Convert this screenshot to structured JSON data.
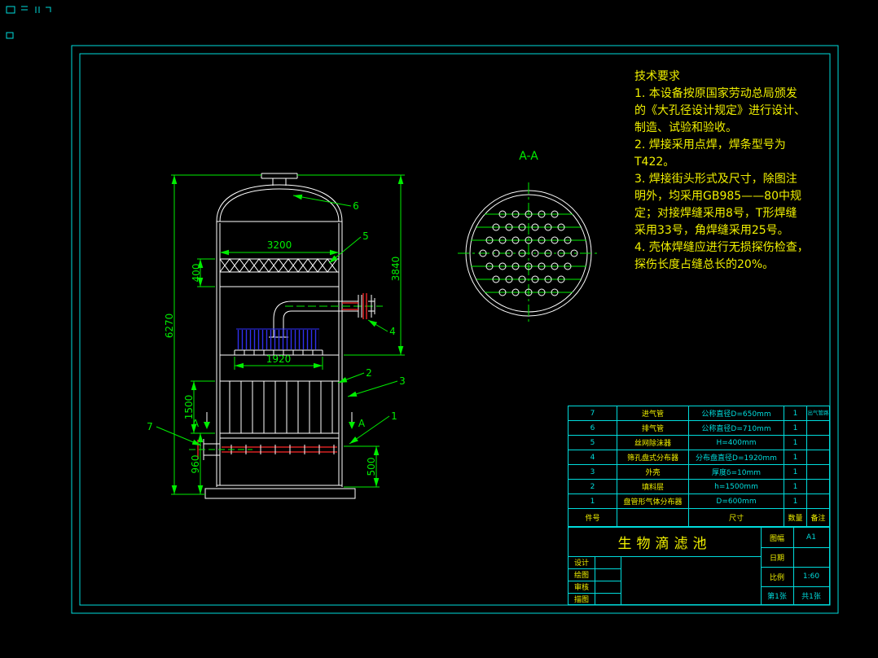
{
  "colors": {
    "background": "#000000",
    "frame": "#00dcdc",
    "line": "#ffffff",
    "dimension": "#00ee00",
    "annotation": "#f0f000",
    "pipe_accent": "#ff2828",
    "liquid_hatch": "#3030ff"
  },
  "tech": {
    "title": "技术要求",
    "body": "1. 本设备按原国家劳动总局颁发\n的《大孔径设计规定》进行设计、\n制造、试验和验收。\n2. 焊接采用点焊，焊条型号为\nT422。\n3. 焊接街头形式及尺寸，除图注\n明外，均采用GB985——80中规\n定；对接焊缝采用8号，T形焊缝\n采用33号，角焊缝采用25号。\n4. 壳体焊缝应进行无损探伤检查，\n探伤长度占缝总长的20%。"
  },
  "dims": {
    "w3200": "3200",
    "h3840": "3840",
    "h400": "400",
    "h6270": "6270",
    "w1920": "1920",
    "h1500": "1500",
    "h960": "960",
    "h500": "500"
  },
  "labels": {
    "n1": "1",
    "n2": "2",
    "n3": "3",
    "n4": "4",
    "n5": "5",
    "n6": "6",
    "n7": "7",
    "section_left": "A",
    "section_right": "A",
    "section_title": "A-A"
  },
  "parts_table": {
    "headers": [
      "件号",
      "",
      "尺寸",
      "数量",
      "备注"
    ],
    "rows": [
      [
        "7",
        "进气管",
        "公称直径D=650mm",
        "1",
        "出气管路"
      ],
      [
        "6",
        "排气管",
        "公称直径D=710mm",
        "1",
        ""
      ],
      [
        "5",
        "丝网除沫器",
        "H=400mm",
        "1",
        ""
      ],
      [
        "4",
        "筛孔盘式分布器",
        "分布盘直径D=1920mm",
        "1",
        ""
      ],
      [
        "3",
        "外壳",
        "厚度δ=10mm",
        "1",
        ""
      ],
      [
        "2",
        "填料层",
        "h=1500mm",
        "1",
        ""
      ],
      [
        "1",
        "盘管形气体分布器",
        "D=600mm",
        "1",
        ""
      ]
    ]
  },
  "title_block": {
    "title": "生物滴滤池",
    "design_label": "设计",
    "draw_label": "绘图",
    "check_label": "审核",
    "trace_label": "描图",
    "sheet_label": "图幅",
    "sheet_value": "A1",
    "date_label": "日期",
    "scale_label": "比例",
    "scale_value": "1:60",
    "page_no": "第1张",
    "page_total": "共1张"
  }
}
